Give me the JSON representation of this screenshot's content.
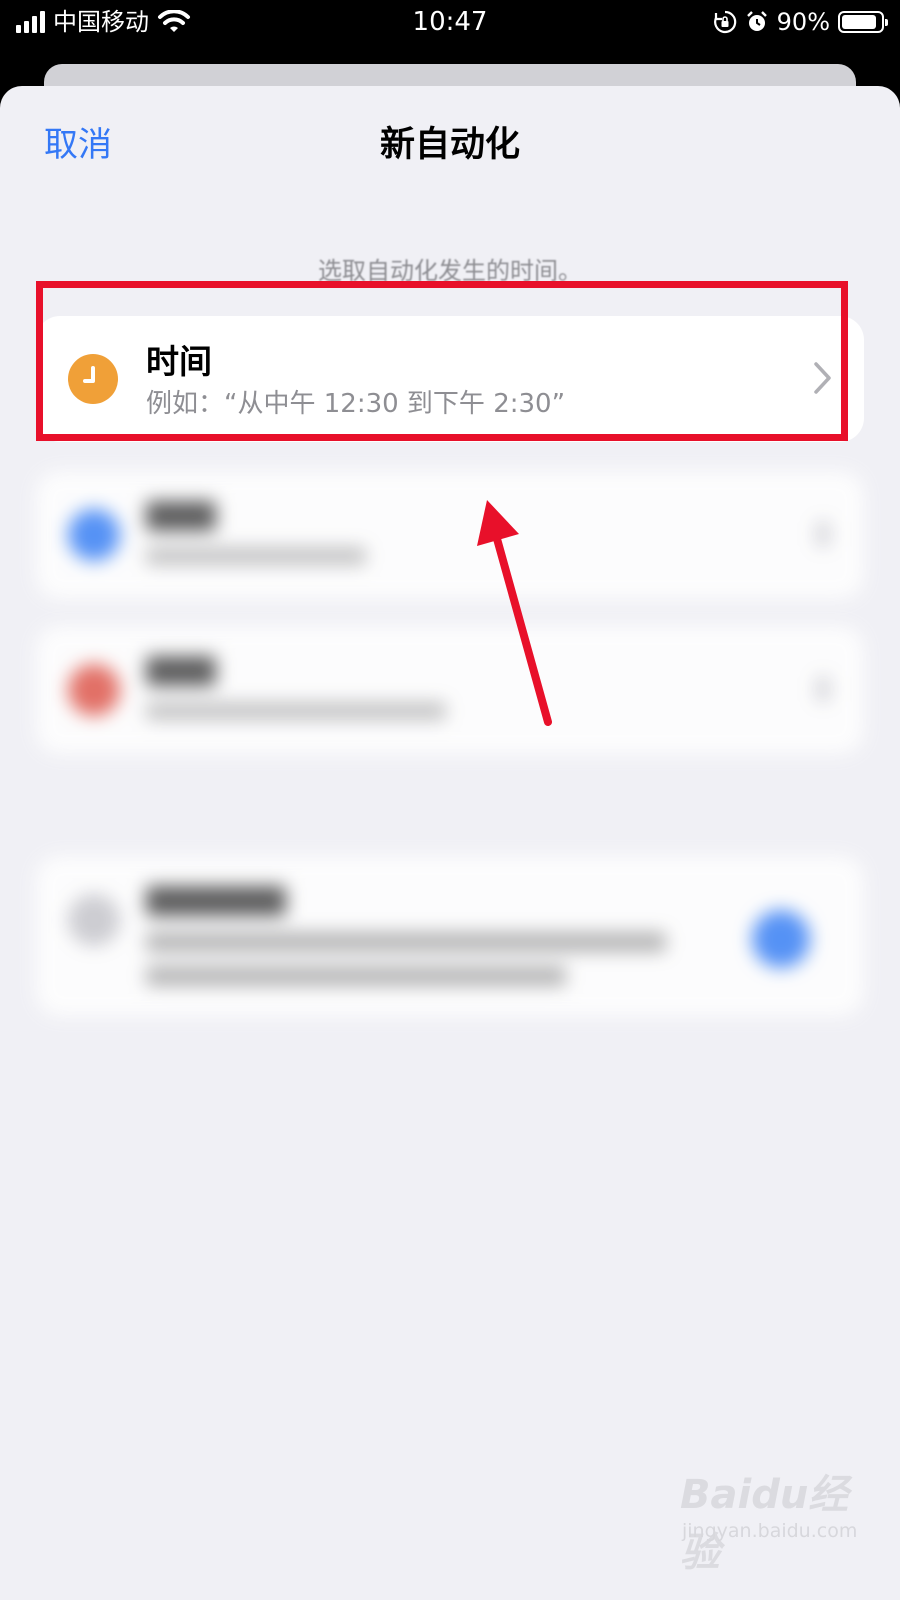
{
  "status_bar": {
    "carrier": "中国移动",
    "time": "10:47",
    "battery_percent": "90%",
    "battery_level": 0.9,
    "signal_bars": 4,
    "icons": [
      "signal-icon",
      "wifi-icon",
      "orientation-lock-icon",
      "alarm-icon",
      "battery-icon"
    ]
  },
  "nav": {
    "cancel_label": "取消",
    "title": "新自动化"
  },
  "hint": "选取自动化发生的时间。",
  "options": [
    {
      "icon": "clock-icon",
      "icon_color": "#F0A038",
      "title": "时间",
      "subtitle": "例如：“从中午 12:30 到下午 2:30”"
    }
  ],
  "blurred_icon_colors": [
    "#3B82F6",
    "#E05A4E",
    "#C7C7CC"
  ],
  "accent_color": "#3478F6",
  "annotation_color": "#E8102A",
  "watermark": {
    "logo": "Baidu经验",
    "url": "jingyan.baidu.com"
  }
}
